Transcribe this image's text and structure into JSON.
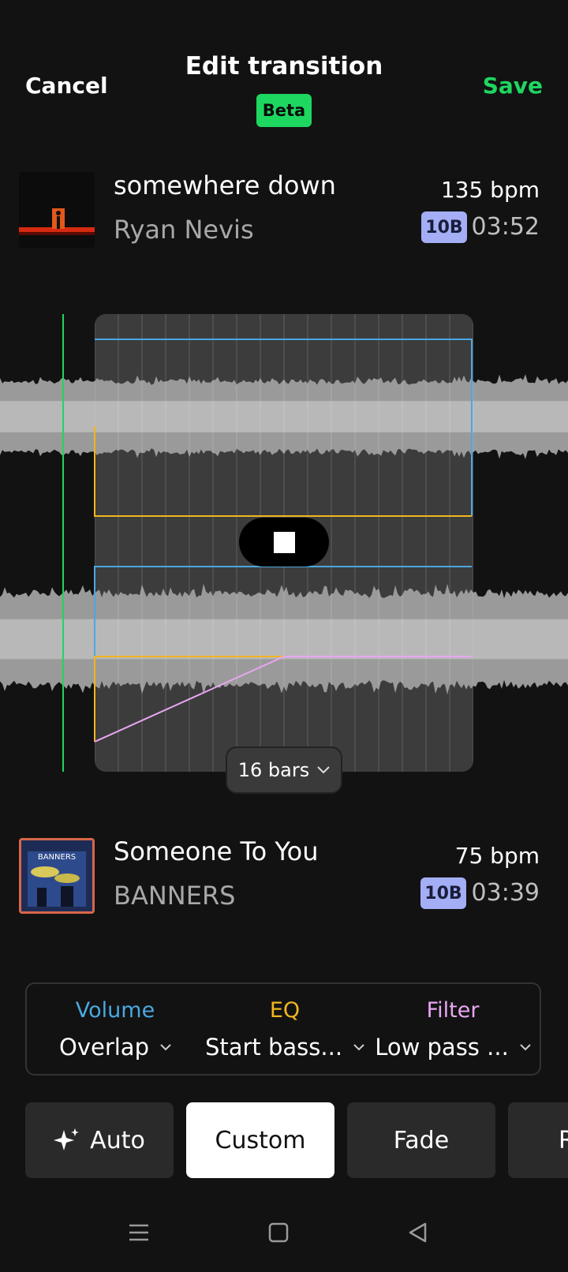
{
  "header": {
    "cancel_label": "Cancel",
    "title": "Edit transition",
    "badge": "Beta",
    "save_label": "Save"
  },
  "track_a": {
    "title": "somewhere down",
    "artist": "Ryan Nevis",
    "bpm": "135 bpm",
    "key": "10B",
    "duration": "03:52"
  },
  "track_b": {
    "title": "Someone To You",
    "artist": "BANNERS",
    "bpm": "75 bpm",
    "key": "10B",
    "duration": "03:39",
    "art_text": "BANNERS"
  },
  "transition": {
    "length_label": "16 bars",
    "stop_icon": "stop-icon"
  },
  "controls": {
    "volume": {
      "label": "Volume",
      "value": "Overlap",
      "color": "#4aa8e0"
    },
    "eq": {
      "label": "EQ",
      "value": "Start bass...",
      "color": "#f2b51e"
    },
    "filter": {
      "label": "Filter",
      "value": "Low pass ...",
      "color": "#e9a6f2"
    }
  },
  "presets": [
    {
      "label": "Auto",
      "icon": "sparkle-icon",
      "active": false
    },
    {
      "label": "Custom",
      "active": true
    },
    {
      "label": "Fade",
      "active": false
    },
    {
      "label": "R",
      "active": false
    }
  ],
  "nav": {
    "menu_icon": "menu-icon",
    "home_icon": "square-icon",
    "back_icon": "back-icon"
  },
  "colors": {
    "accent_green": "#1ed760",
    "key_badge": "#a3aef5",
    "volume_line": "#4aa8e0",
    "eq_line": "#f2b51e",
    "filter_line": "#e9a6f2"
  }
}
